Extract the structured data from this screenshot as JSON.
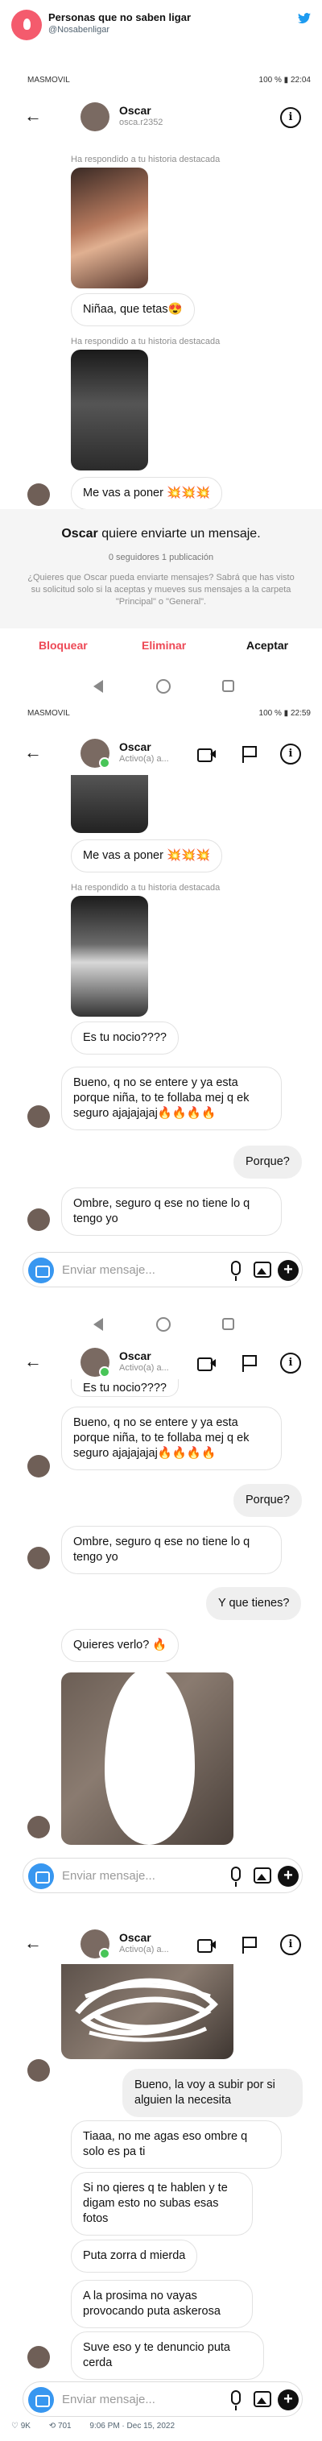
{
  "tweet": {
    "author_name": "Personas que no saben ligar",
    "author_handle": "@Nosabenligar",
    "likes": "9K",
    "retweets": "701",
    "timestamp": "9:06 PM · Dec 15, 2022"
  },
  "screens": [
    {
      "status": {
        "carrier": "MASMOVIL",
        "battery": "100 %",
        "time": "22:04"
      },
      "profile": {
        "name": "Oscar",
        "subtitle": "osca.r2352"
      },
      "story_reply_note_1": "Ha respondido a tu historia destacada",
      "story_reply_note_2": "Ha respondido a tu historia destacada",
      "messages": [
        "Niñaa, que tetas😍",
        "Me vas a poner 💥💥💥"
      ],
      "request": {
        "name": "Oscar",
        "title_rest": "quiere enviarte un mensaje.",
        "followers": "0 seguidores 1 publicación",
        "description": "¿Quieres que Oscar pueda enviarte mensajes? Sabrá que has visto su solicitud solo si la aceptas y mueves sus mensajes a la carpeta \"Principal\" o \"General\"."
      },
      "buttons": {
        "block": "Bloquear",
        "delete": "Eliminar",
        "accept": "Aceptar"
      }
    },
    {
      "status": {
        "carrier": "MASMOVIL",
        "battery": "100 %",
        "time": "22:59"
      },
      "profile": {
        "name": "Oscar",
        "subtitle": "Activo(a) a..."
      },
      "story_reply_note": "Ha respondido a tu historia destacada",
      "messages": [
        "Me vas a poner 💥💥💥",
        "Es tu nocio????",
        "Bueno, q no se entere y ya esta porque niña, to te follaba mej q ek seguro ajajajajaj🔥🔥🔥🔥",
        "Porque?",
        "Ombre, seguro q ese no tiene lo q tengo yo"
      ],
      "composer_placeholder": "Enviar mensaje..."
    },
    {
      "profile": {
        "name": "Oscar",
        "subtitle": "Activo(a) a..."
      },
      "messages": [
        "Es tu nocio????",
        "Bueno, q no se entere y ya esta porque niña, to te follaba mej q ek seguro ajajajajaj🔥🔥🔥🔥",
        "Porque?",
        "Ombre, seguro q ese no tiene lo q tengo yo",
        "Y que tienes?",
        "Quieres verlo? 🔥"
      ],
      "composer_placeholder": "Enviar mensaje..."
    },
    {
      "profile": {
        "name": "Oscar",
        "subtitle": "Activo(a) a..."
      },
      "messages": [
        "Bueno, la voy a subir por si alguien la necesita",
        "Tiaaa, no me agas eso ombre q solo es pa ti",
        "Si no qieres q te hablen y te digam esto no subas esas fotos",
        "Puta zorra d mierda",
        "A la prosima no vayas provocando puta askerosa",
        "Suve eso y te denuncio puta cerda"
      ],
      "composer_placeholder": "Enviar mensaje..."
    }
  ],
  "colors": {
    "instagram_blue": "#3897f0",
    "block_red": "#ed4956",
    "twitter_blue": "#1d9bf0"
  }
}
